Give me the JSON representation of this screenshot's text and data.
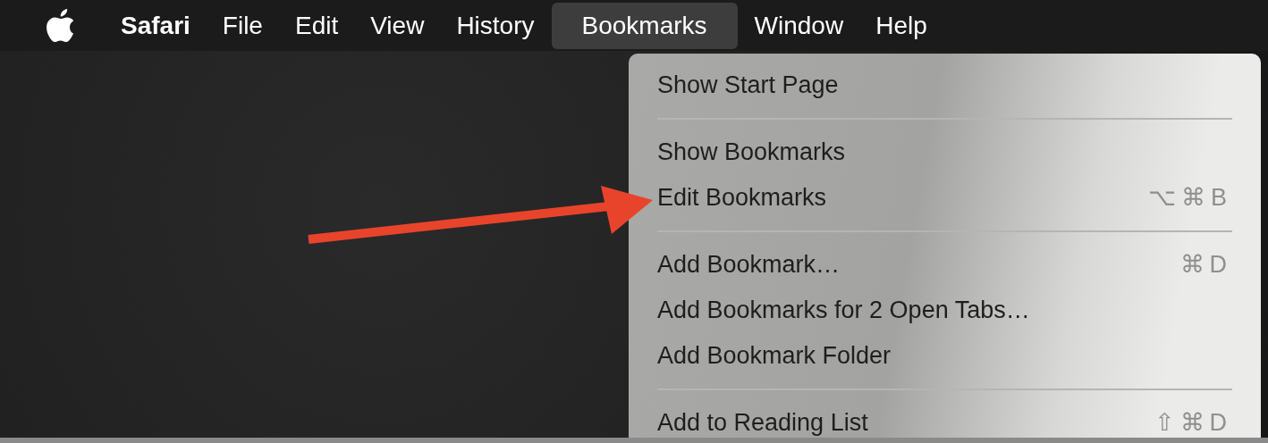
{
  "menu_bar": {
    "items": [
      {
        "label": "Safari",
        "bold": true,
        "selected": false
      },
      {
        "label": "File",
        "bold": false,
        "selected": false
      },
      {
        "label": "Edit",
        "bold": false,
        "selected": false
      },
      {
        "label": "View",
        "bold": false,
        "selected": false
      },
      {
        "label": "History",
        "bold": false,
        "selected": false
      },
      {
        "label": "Bookmarks",
        "bold": false,
        "selected": true
      },
      {
        "label": "Window",
        "bold": false,
        "selected": false
      },
      {
        "label": "Help",
        "bold": false,
        "selected": false
      }
    ]
  },
  "dropdown": {
    "items": [
      {
        "kind": "item",
        "label": "Show Start Page"
      },
      {
        "kind": "separator"
      },
      {
        "kind": "item",
        "label": "Show Bookmarks"
      },
      {
        "kind": "item",
        "label": "Edit Bookmarks",
        "shortcut": "⌥⌘B"
      },
      {
        "kind": "separator"
      },
      {
        "kind": "item",
        "label": "Add Bookmark…",
        "shortcut": "⌘D"
      },
      {
        "kind": "item",
        "label": "Add Bookmarks for 2 Open Tabs…"
      },
      {
        "kind": "item",
        "label": "Add Bookmark Folder"
      },
      {
        "kind": "separator"
      },
      {
        "kind": "item",
        "label": "Add to Reading List",
        "shortcut": "⇧⌘D"
      }
    ]
  }
}
